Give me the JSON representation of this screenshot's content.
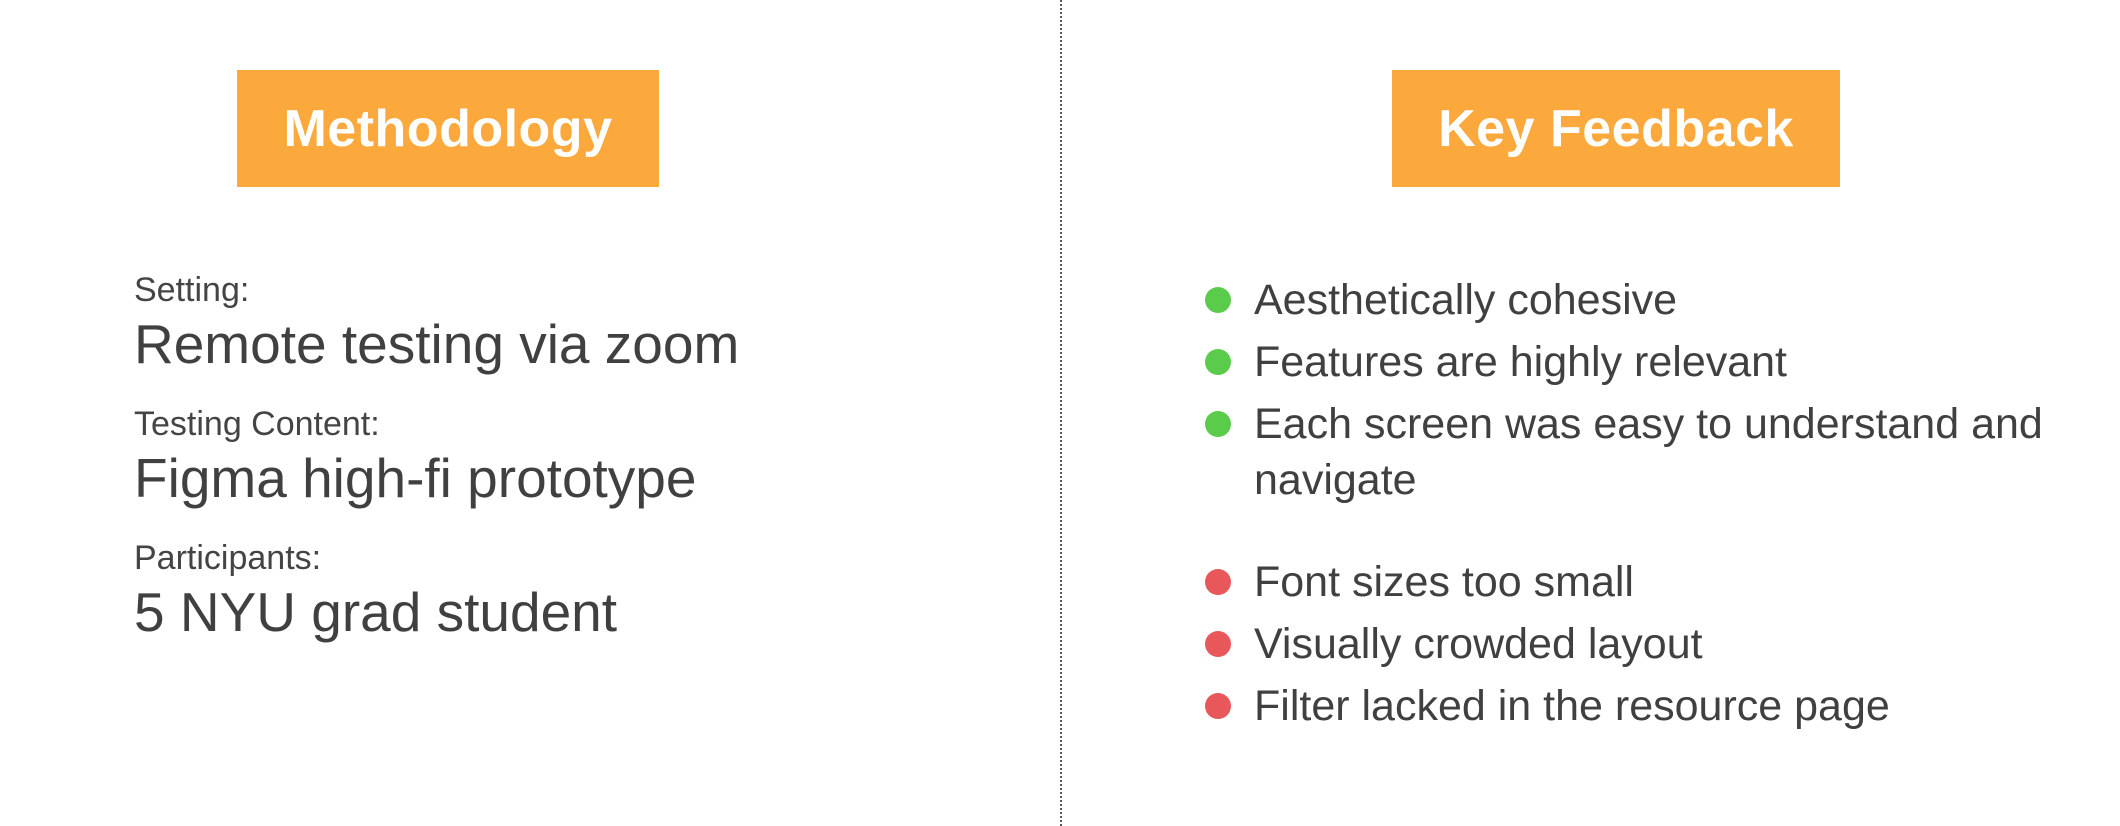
{
  "colors": {
    "header_background": "#FBA93C",
    "positive_bullet": "#5BCB4B",
    "negative_bullet": "#E8575A",
    "text": "#404040"
  },
  "methodology": {
    "title": "Methodology",
    "items": [
      {
        "label": "Setting:",
        "value": "Remote testing via zoom"
      },
      {
        "label": "Testing Content:",
        "value": "Figma high-fi prototype"
      },
      {
        "label": "Participants:",
        "value": "5 NYU grad student"
      }
    ]
  },
  "key_feedback": {
    "title": "Key Feedback",
    "positive": [
      "Aesthetically cohesive",
      "Features are highly relevant",
      "Each screen was easy to understand and navigate"
    ],
    "negative": [
      "Font sizes too small",
      "Visually crowded layout",
      "Filter lacked in the resource page"
    ]
  }
}
